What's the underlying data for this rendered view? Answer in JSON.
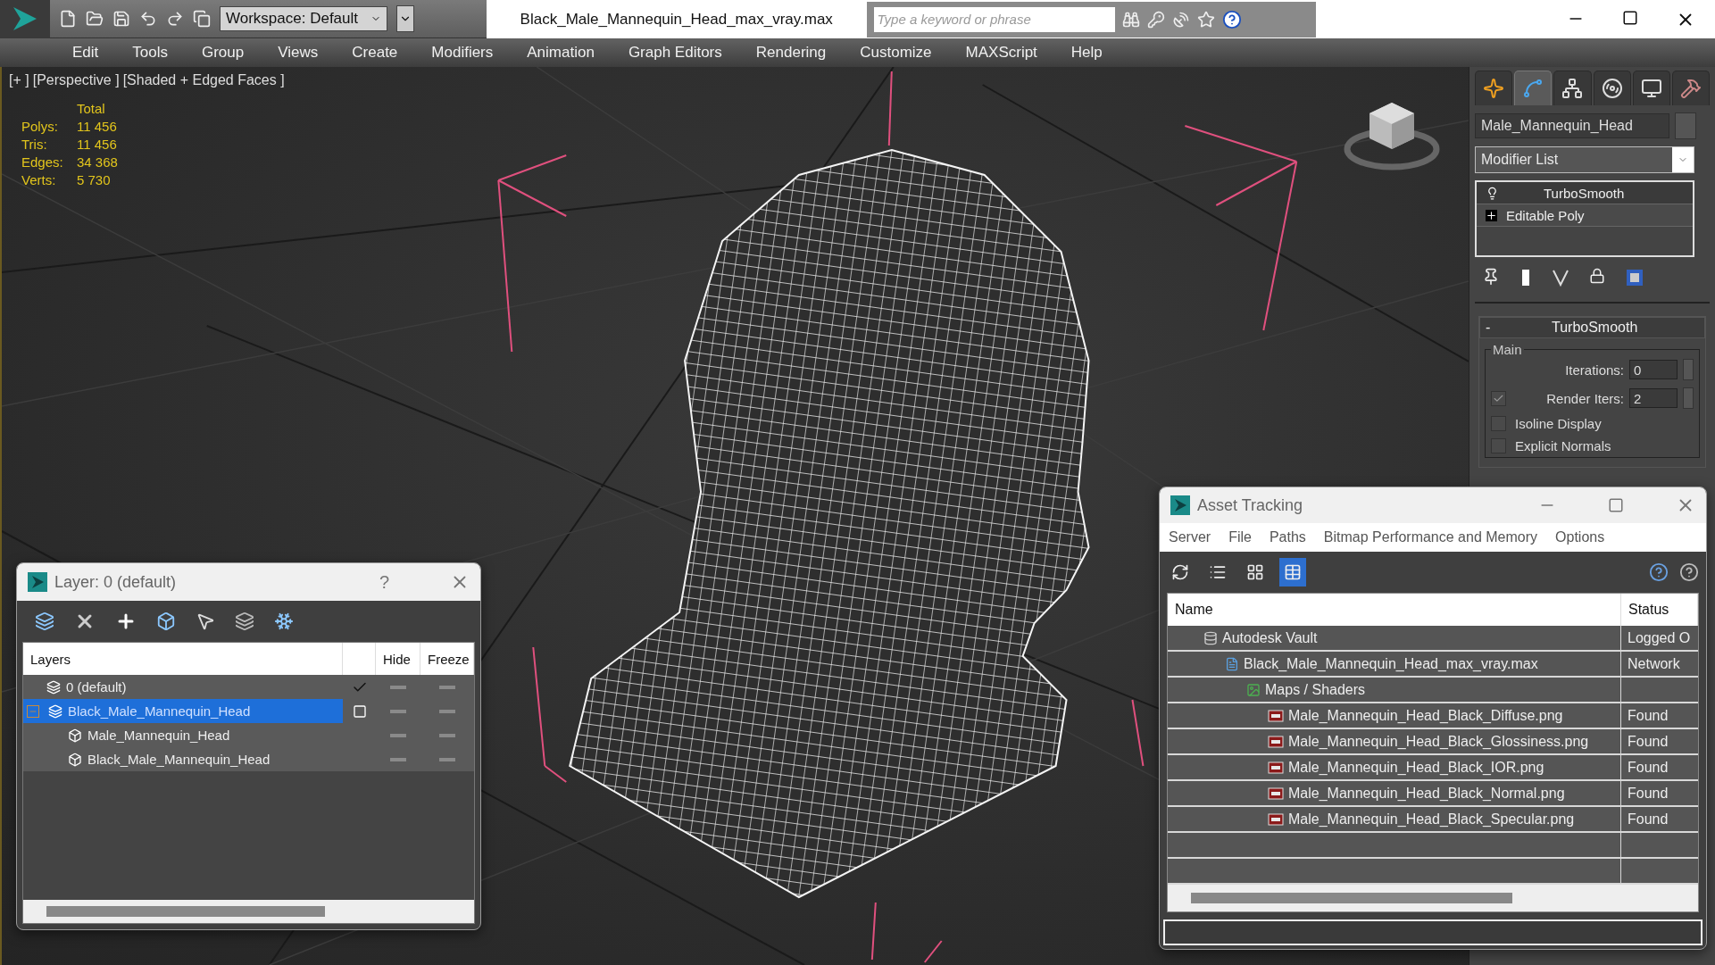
{
  "app": {
    "workspace": "Workspace: Default",
    "title": "Black_Male_Mannequin_Head_max_vray.max",
    "search_placeholder": "Type a keyword or phrase"
  },
  "menu": [
    "Edit",
    "Tools",
    "Group",
    "Views",
    "Create",
    "Modifiers",
    "Animation",
    "Graph Editors",
    "Rendering",
    "Customize",
    "MAXScript",
    "Help"
  ],
  "viewport": {
    "labels": [
      "[+ ]",
      "[Perspective ]",
      "[Shaded + Edged Faces ]"
    ],
    "stats": {
      "header": "Total",
      "rows": [
        {
          "label": "Polys:",
          "value": "11 456"
        },
        {
          "label": "Tris:",
          "value": "11 456"
        },
        {
          "label": "Edges:",
          "value": "34 368"
        },
        {
          "label": "Verts:",
          "value": "5 730"
        }
      ]
    }
  },
  "command_panel": {
    "tabs": [
      {
        "kind": "create",
        "selected": false
      },
      {
        "kind": "modify",
        "selected": true
      },
      {
        "kind": "hierarchy",
        "selected": false
      },
      {
        "kind": "motion",
        "selected": false
      },
      {
        "kind": "display",
        "selected": false
      },
      {
        "kind": "utilities",
        "selected": false
      }
    ],
    "object_name": "Male_Mannequin_Head",
    "modifier_list": "Modifier List",
    "stack": [
      {
        "label": "TurboSmooth",
        "kind": "modifier"
      },
      {
        "label": "Editable Poly",
        "kind": "base"
      }
    ],
    "rollout": {
      "collapse": "-",
      "title": "TurboSmooth",
      "group": "Main",
      "spinners": [
        {
          "label": "Iterations:",
          "value": "0"
        },
        {
          "label": "Render Iters:",
          "value": "2",
          "checked": true
        }
      ],
      "options": [
        {
          "label": "Isoline Display",
          "checked": false
        },
        {
          "label": "Explicit Normals",
          "checked": false
        }
      ]
    }
  },
  "layer_dialog": {
    "title": "Layer: 0 (default)",
    "help": "?",
    "columns": [
      "Layers",
      "Hide",
      "Freeze"
    ],
    "rows": [
      {
        "name": "0 (default)",
        "kind": "layer",
        "current": true,
        "selected": false
      },
      {
        "name": "Black_Male_Mannequin_Head",
        "kind": "layer",
        "current": false,
        "selected": true,
        "expanded": true,
        "children": [
          {
            "name": "Male_Mannequin_Head",
            "kind": "object",
            "selected": false
          },
          {
            "name": "Black_Male_Mannequin_Head",
            "kind": "object",
            "selected": false
          }
        ]
      }
    ]
  },
  "asset_dialog": {
    "title": "Asset Tracking",
    "menu": [
      "Server",
      "File",
      "Paths",
      "Bitmap Performance and Memory",
      "Options"
    ],
    "tools": [
      {
        "kind": "refresh",
        "selected": false
      },
      {
        "kind": "list",
        "selected": false
      },
      {
        "kind": "thumbnails",
        "selected": false
      },
      {
        "kind": "table",
        "selected": true
      }
    ],
    "columns": [
      "Name",
      "Status"
    ],
    "rows": [
      {
        "name": "Autodesk Vault",
        "kind": "vault",
        "status": "Logged O",
        "children": [
          {
            "name": "Black_Male_Mannequin_Head_max_vray.max",
            "kind": "scene",
            "status": "Network",
            "children": [
              {
                "name": "Maps / Shaders",
                "kind": "folder",
                "children": [
                  {
                    "name": "Male_Mannequin_Head_Black_Diffuse.png",
                    "kind": "image",
                    "status": "Found"
                  },
                  {
                    "name": "Male_Mannequin_Head_Black_Glossiness.png",
                    "kind": "image",
                    "status": "Found"
                  },
                  {
                    "name": "Male_Mannequin_Head_Black_IOR.png",
                    "kind": "image",
                    "status": "Found"
                  },
                  {
                    "name": "Male_Mannequin_Head_Black_Normal.png",
                    "kind": "image",
                    "status": "Found"
                  },
                  {
                    "name": "Male_Mannequin_Head_Black_Specular.png",
                    "kind": "image",
                    "status": "Found"
                  }
                ]
              }
            ]
          }
        ]
      }
    ]
  }
}
